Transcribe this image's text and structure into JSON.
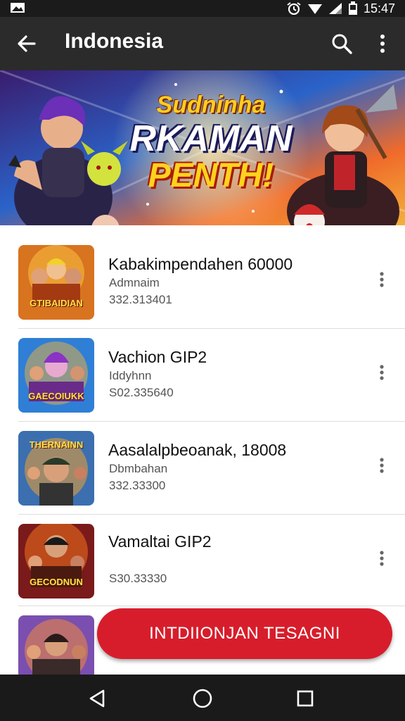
{
  "status_bar": {
    "time": "15:47",
    "icons": [
      "image-icon",
      "alarm-icon",
      "wifi-icon",
      "signal-icon",
      "battery-icon"
    ]
  },
  "app_bar": {
    "title": "Indonesia",
    "icons": [
      "back-arrow-icon",
      "search-icon",
      "more-vert-icon"
    ]
  },
  "banner": {
    "line1": "Sudninha",
    "line2": "RKAMAN",
    "line3": "PENTH!"
  },
  "items": [
    {
      "title": "Kabakimpendahen 60000",
      "subtitle": "Admnaim",
      "number": "332.313401",
      "thumb_label": "GTIBAIDIAN"
    },
    {
      "title": "Vachion GIP2",
      "subtitle": "Iddyhnn",
      "number": "S02.335640",
      "thumb_label": "GAECOIUKK"
    },
    {
      "title": "Aasalalpbeoanak, 18008",
      "subtitle": "Dbmbahan",
      "number": "332.33300",
      "thumb_label": "THERNAINN"
    },
    {
      "title": "Vamaltai GIP2",
      "subtitle": "",
      "number": "S30.33330",
      "thumb_label": "GECODNUN"
    }
  ],
  "cta": {
    "label": "INTDIIONJAN TESAGNI"
  },
  "nav_bar": {
    "icons": [
      "nav-back-icon",
      "nav-home-icon",
      "nav-recents-icon"
    ]
  },
  "colors": {
    "app_bar": "#2b2b2b",
    "status_bar": "#1b1b1b",
    "accent": "#d71d2b",
    "nav_bar": "#1a1a1a"
  }
}
